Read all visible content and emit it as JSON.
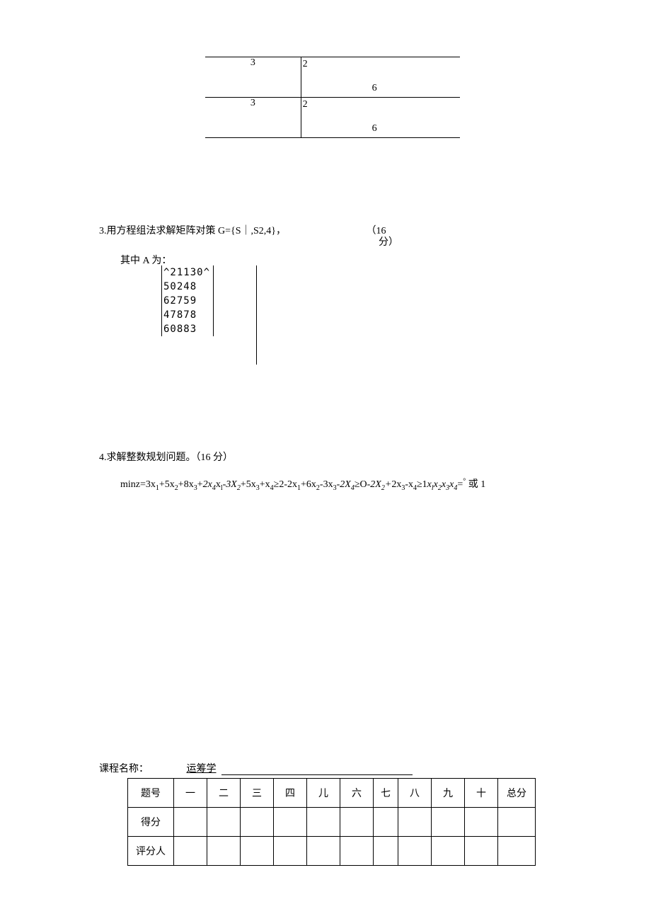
{
  "top_table": {
    "row1": {
      "left": "3",
      "top": "2",
      "bottom": "6"
    },
    "row2": {
      "left": "3",
      "top": "2",
      "bottom": "6"
    }
  },
  "q3": {
    "heading": "3.用方程组法求解矩阵对策 G={S｜,S2,4}，",
    "points": "（16",
    "points_sub": "分）",
    "matrix_label": "其中 A 为：",
    "matrix_rows": [
      "^21130^",
      "50248",
      "62759",
      "47878",
      "60883"
    ]
  },
  "q4": {
    "heading": "4.求解整数规划问题。（16 分）",
    "formula_prefix": "minz=3x",
    "formula_parts": {
      "p1": "+5x",
      "p2": "+8x",
      "p3": "+",
      "p4": "x",
      "p5": "-",
      "p6": "+5x",
      "p7": "+x",
      "p8": "≥2-2x",
      "p9": "+6x",
      "p10": "-3x",
      "p11": "-",
      "p12": "≥O-",
      "p13": "2x",
      "p14": "-x",
      "p15": "≥1",
      "p16": "x",
      "p17": "x",
      "p18": "x",
      "p19": "=",
      "tail": " 或 1"
    },
    "italic": {
      "two": "2",
      "x4": "x₄",
      "x1": "xₗ",
      "three": "3",
      "X2": "X₂",
      "X4": "X₄",
      "plus": "+",
      "x2": "x₂",
      "x3": "x₃",
      "xl": "xₗ",
      "deg": "°"
    }
  },
  "course": {
    "label": "课程名称：",
    "name": "运筹学"
  },
  "score_table": {
    "row_labels": [
      "题号",
      "得分",
      "评分人"
    ],
    "cols": [
      "一",
      "二",
      "三",
      "四",
      "儿",
      "六",
      "七",
      "八",
      "九",
      "十",
      "总分"
    ]
  }
}
